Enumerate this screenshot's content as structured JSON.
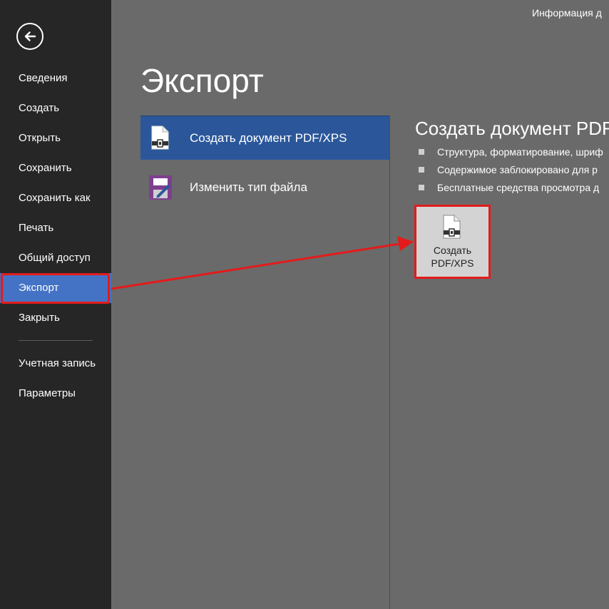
{
  "header": {
    "info_text": "Информация д"
  },
  "sidebar": {
    "back_icon": "arrow-left-icon",
    "items": [
      {
        "label": "Сведения"
      },
      {
        "label": "Создать"
      },
      {
        "label": "Открыть"
      },
      {
        "label": "Сохранить"
      },
      {
        "label": "Сохранить как"
      },
      {
        "label": "Печать"
      },
      {
        "label": "Общий доступ"
      },
      {
        "label": "Экспорт",
        "active": true
      },
      {
        "label": "Закрыть"
      }
    ],
    "bottom_items": [
      {
        "label": "Учетная запись"
      },
      {
        "label": "Параметры"
      }
    ]
  },
  "main": {
    "title": "Экспорт",
    "options": [
      {
        "label": "Создать документ PDF/XPS",
        "icon": "pdf-document-icon",
        "selected": true
      },
      {
        "label": "Изменить тип файла",
        "icon": "change-file-type-icon",
        "selected": false
      }
    ],
    "detail": {
      "title": "Создать документ PDF/",
      "bullets": [
        "Структура, форматирование, шриф",
        "Содержимое заблокировано для р",
        "Бесплатные средства просмотра д"
      ],
      "button_line1": "Создать",
      "button_line2": "PDF/XPS",
      "button_icon": "pdf-document-icon"
    }
  },
  "colors": {
    "sidebar_bg": "#262626",
    "main_bg": "#6a6a6a",
    "accent": "#2b579a",
    "sidebar_active": "#4472c4",
    "highlight": "#e31b1b"
  }
}
